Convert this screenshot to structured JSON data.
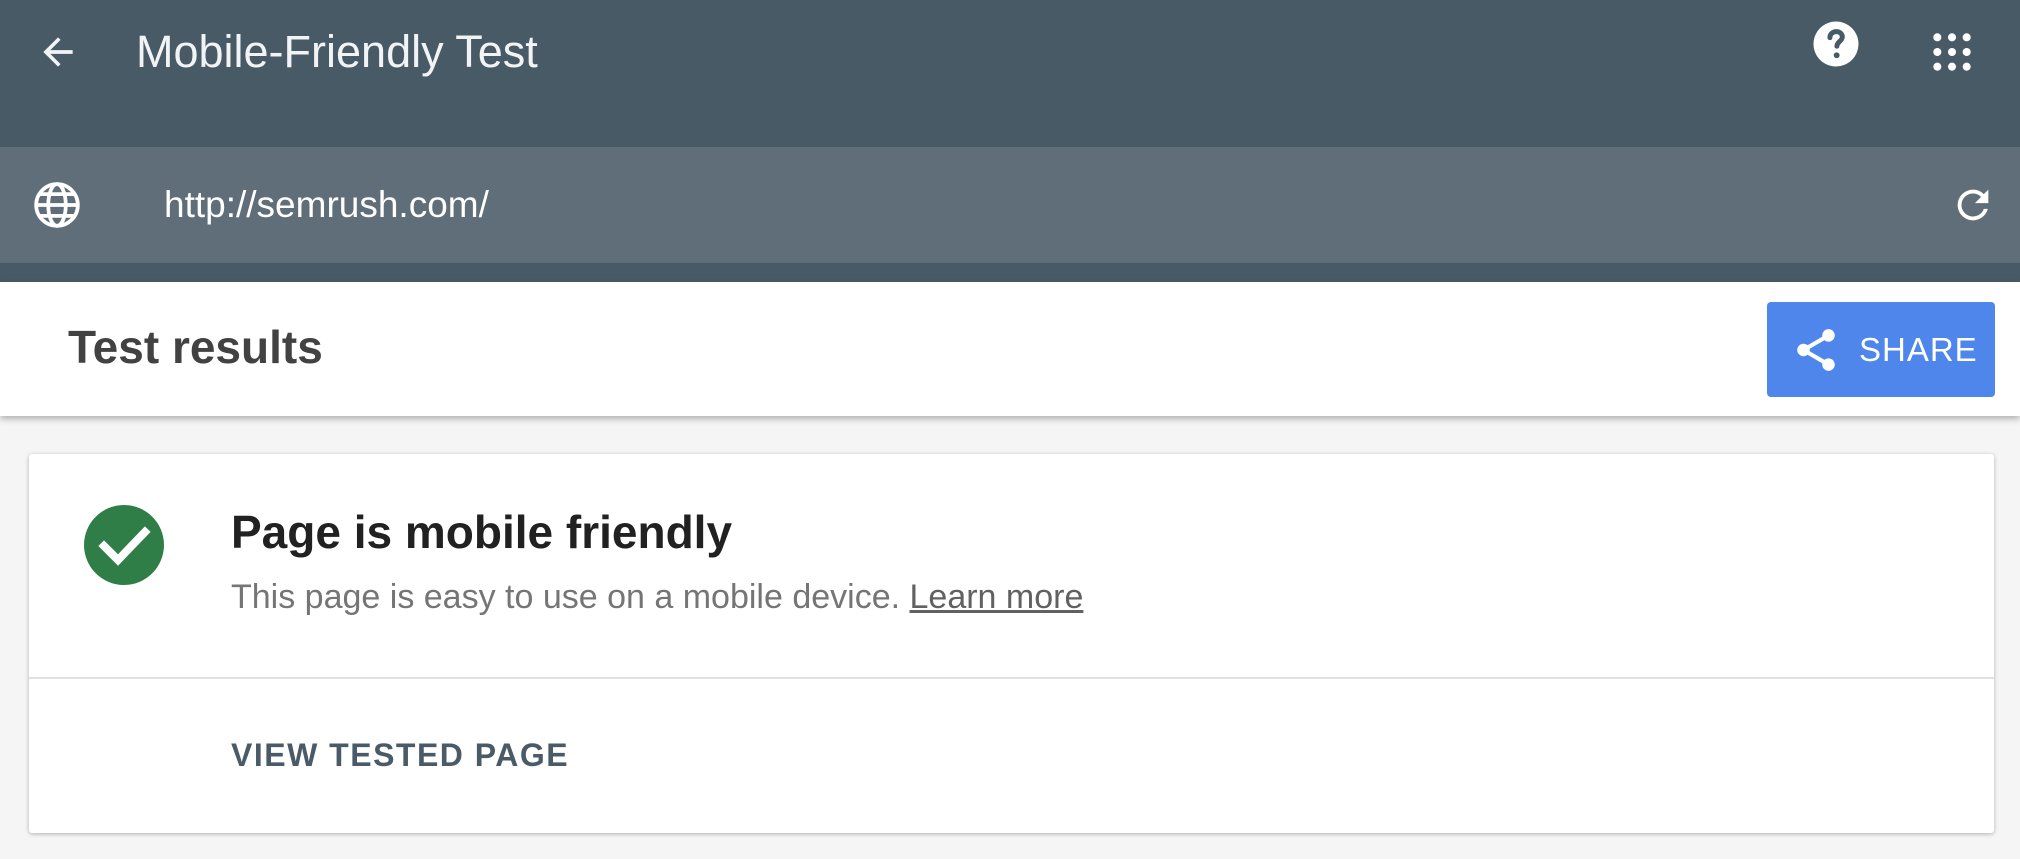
{
  "header": {
    "title": "Mobile-Friendly Test",
    "back_icon": "arrow-back-icon",
    "help_icon": "help-circle-icon",
    "apps_icon": "apps-grid-icon"
  },
  "url_bar": {
    "value": "http://semrush.com/",
    "globe_icon": "globe-icon",
    "reload_icon": "reload-icon"
  },
  "results": {
    "title": "Test results",
    "share_label": "SHARE",
    "share_icon": "share-icon"
  },
  "card": {
    "status_title": "Page is mobile friendly",
    "status_desc": "This page is easy to use on a mobile device.",
    "learn_more": "Learn more",
    "view_button": "VIEW TESTED PAGE",
    "check_icon": "check-circle-icon"
  },
  "colors": {
    "header_bg": "#475a66",
    "urlbar_bg": "#5f6e78",
    "share_bg": "#4f86ec",
    "success_green": "#2f7d47"
  }
}
